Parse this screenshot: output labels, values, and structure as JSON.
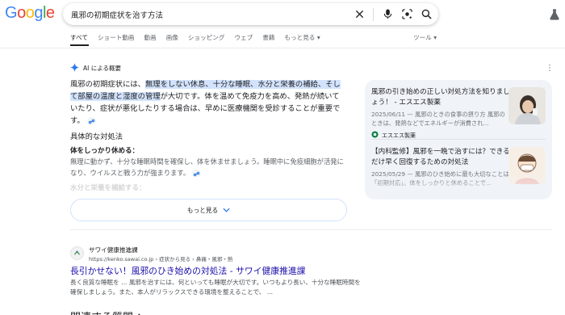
{
  "logo": {
    "letters": [
      "G",
      "o",
      "o",
      "g",
      "l",
      "e"
    ],
    "colors": [
      "#4285f4",
      "#ea4335",
      "#fbbc05",
      "#4285f4",
      "#34a853",
      "#ea4335"
    ]
  },
  "search": {
    "query": "風邪の初期症状を治す方法"
  },
  "icons": {
    "clear": "close-icon",
    "voice": "mic-icon",
    "lens": "lens-icon",
    "search": "search-icon",
    "account": "flask-icon"
  },
  "tabs": [
    "すべて",
    "ショート動画",
    "動画",
    "画像",
    "ショッピング",
    "ウェブ",
    "書籍",
    "もっと見る"
  ],
  "tools_label": "ツール",
  "ai_overview": {
    "label": "AI による概要",
    "p1": "風邪の初期症状には、",
    "p1_hl": "無理をしない休息、十分な睡眠、水分と栄養の補給、そして部屋の温度と湿度の管理",
    "p1_rest": "が大切です。体を温めて免疫力を高め、発熱が続いていたり、症状が悪化したりする場合は、早めに医療機関を受診することが重要です。",
    "sub_heading": "具体的な対処法",
    "item1_title": "体をしっかり休める：",
    "item1_text": "無理に動かず、十分な睡眠時間を確保し、体を休ませましょう。睡眠中に免疫細胞が活発になり、ウイルスと戦う力が強まります。",
    "item2_title": "水分と栄養を補給する：",
    "more_label": "もっと見る"
  },
  "side_sources": [
    {
      "title": "風邪の引き始めの正しい対処方法を知りましょう！ - エスエス製薬",
      "snippet": "2025/06/11 — 風邪のときの食事の摂り方 風邪のときは、発熱などでエネルギーが消費され...",
      "source": "エスエス製薬"
    },
    {
      "title": "【内科監修】風邪を一晩で治すには？できるだけ早く回復するための対処法",
      "snippet": "2025/05/29 — 風邪のひき始めに最も大切なことは「初期対応」。体をしっかりと休めることで..."
    }
  ],
  "result": {
    "site": "サワイ健康推進課",
    "url": "https://kenko.sawai.co.jp › 症状から見る › 鼻痛・風邪・熱",
    "title": "長引かせない！風邪のひき始めの対処法 - サワイ健康推進課",
    "snippet": "長く良質な睡眠を ... 風邪を治すには、何といっても睡眠が大切です。いつもより長い、十分な睡眠時間を確保しましょう。また、本人がリラックスできる環境を整えることで、 ..."
  },
  "related_heading": "関連する質問 ："
}
